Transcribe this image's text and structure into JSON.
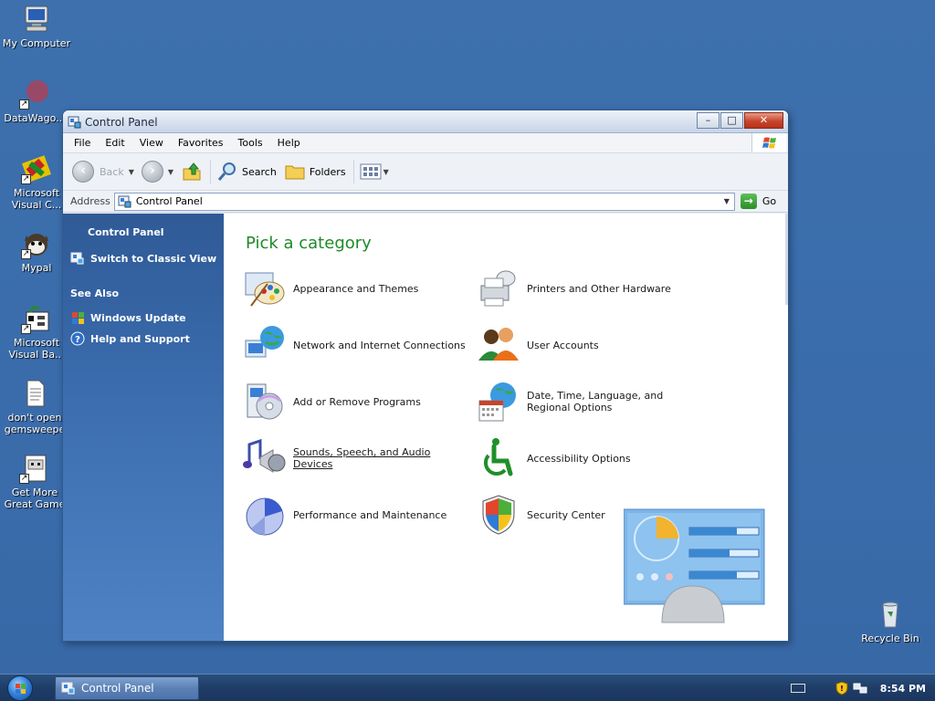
{
  "desktop": {
    "icons": [
      {
        "label": "My Computer"
      },
      {
        "label": "DataWago..."
      },
      {
        "label_line1": "Microsoft",
        "label_line2": "Visual C..."
      },
      {
        "label": "Mypal"
      },
      {
        "label_line1": "Microsoft",
        "label_line2": "Visual Ba..."
      },
      {
        "label_line1": "don't open",
        "label_line2": "gemsweepe"
      },
      {
        "label_line1": "Get More",
        "label_line2": "Great Game"
      },
      {
        "label": "Recycle Bin"
      }
    ]
  },
  "window": {
    "title": "Control Panel",
    "buttons": {
      "minimize": "–",
      "restore": "□",
      "close": "✕"
    },
    "menu": [
      "File",
      "Edit",
      "View",
      "Favorites",
      "Tools",
      "Help"
    ],
    "toolbar": {
      "back": "Back",
      "search": "Search",
      "folders": "Folders"
    },
    "address": {
      "label": "Address",
      "value": "Control Panel",
      "go": "Go"
    }
  },
  "taskpane": {
    "title": "Control Panel",
    "switch_view": "Switch to Classic View",
    "see_also_title": "See Also",
    "see_also": [
      "Windows Update",
      "Help and Support"
    ]
  },
  "main": {
    "heading": "Pick a category",
    "categories": [
      {
        "label": "Appearance and Themes",
        "icon": "appearance-icon"
      },
      {
        "label": "Printers and Other Hardware",
        "icon": "printer-icon"
      },
      {
        "label": "Network and Internet Connections",
        "icon": "network-icon"
      },
      {
        "label": "User Accounts",
        "icon": "users-icon"
      },
      {
        "label": "Add or Remove Programs",
        "icon": "programs-icon"
      },
      {
        "label": "Date, Time, Language, and Regional Options",
        "icon": "datetime-icon"
      },
      {
        "label": "Sounds, Speech, and Audio Devices",
        "icon": "sound-icon"
      },
      {
        "label": "Accessibility Options",
        "icon": "accessibility-icon"
      },
      {
        "label": "Performance and Maintenance",
        "icon": "performance-icon"
      },
      {
        "label": "Security Center",
        "icon": "shield-icon"
      }
    ]
  },
  "taskbar": {
    "task_label": "Control Panel",
    "clock": "8:54 PM"
  },
  "colors": {
    "desktop": "#3a6ea5",
    "heading_green": "#1e8a28",
    "taskpane_blue": "#2f5a96",
    "close_red": "#c8452c"
  }
}
